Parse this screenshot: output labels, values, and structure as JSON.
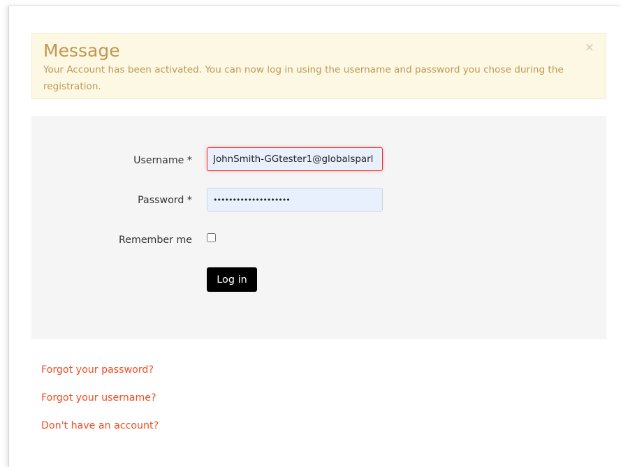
{
  "message": {
    "heading": "Message",
    "text": "Your Account has been activated. You can now log in using the username and password you chose during the registration.",
    "close_symbol": "×"
  },
  "login_form": {
    "username_label": "Username *",
    "username_value": "JohnSmith-GGtester1@globalsparl",
    "password_label": "Password *",
    "password_value": "••••••••••••••••••••",
    "remember_label": "Remember me",
    "remember_checked": false,
    "submit_label": "Log in"
  },
  "links": {
    "forgot_password": "Forgot your password?",
    "forgot_username": "Forgot your username?",
    "register": "Don't have an account?"
  },
  "colors": {
    "alert_background": "#fcf8e3",
    "alert_text": "#c09853",
    "form_background": "#f5f5f5",
    "button_background": "#000000",
    "link": "#f04d23",
    "invalid_border": "#e9322d"
  }
}
